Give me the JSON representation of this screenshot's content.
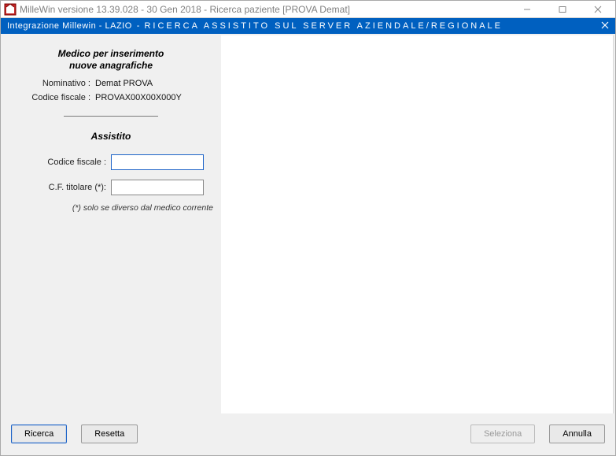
{
  "os_titlebar": {
    "title": "MilleWin versione 13.39.028 - 30 Gen 2018 - Ricerca paziente [PROVA Demat]"
  },
  "header": {
    "left": "Integrazione Millewin - LAZIO",
    "dash": "-",
    "main": "RICERCA ASSISTITO SUL SERVER AZIENDALE/REGIONALE"
  },
  "medico": {
    "title_line1": "Medico per inserimento",
    "title_line2": "nuove anagrafiche",
    "nominativo_label": "Nominativo :",
    "nominativo_value": "Demat PROVA",
    "codice_fiscale_label": "Codice fiscale :",
    "codice_fiscale_value": "PROVAX00X00X000Y"
  },
  "assistito": {
    "title": "Assistito",
    "codice_fiscale_label": "Codice fiscale :",
    "codice_fiscale_value": "",
    "cf_titolare_label": "C.F. titolare (*):",
    "cf_titolare_value": "",
    "hint": "(*) solo se diverso dal medico corrente"
  },
  "buttons": {
    "ricerca": "Ricerca",
    "resetta": "Resetta",
    "seleziona": "Seleziona",
    "annulla": "Annulla"
  }
}
